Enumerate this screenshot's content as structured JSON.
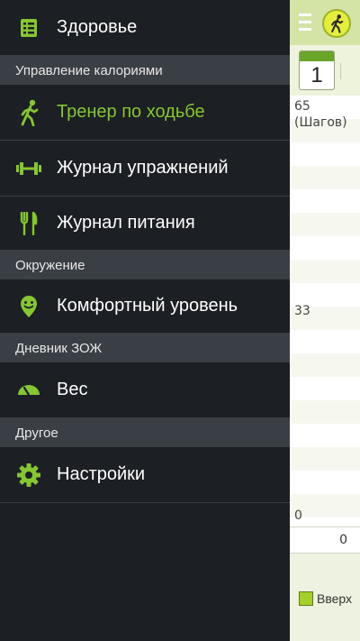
{
  "drawer": {
    "health": {
      "label": "Здоровье",
      "icon": "list-icon"
    },
    "sections": {
      "calories": "Управление калориями",
      "environment": "Окружение",
      "diary": "Дневник ЗОЖ",
      "other": "Другое"
    },
    "items": {
      "walking_coach": {
        "label": "Тренер по ходьбе",
        "icon": "walker-icon",
        "active": true
      },
      "exercise_log": {
        "label": "Журнал упражнений",
        "icon": "dumbbell-icon"
      },
      "food_log": {
        "label": "Журнал питания",
        "icon": "fork-knife-icon"
      },
      "comfort_level": {
        "label": "Комфортный уровень",
        "icon": "smiley-icon"
      },
      "weight": {
        "label": "Вес",
        "icon": "scale-icon"
      },
      "settings": {
        "label": "Настройки",
        "icon": "gear-icon"
      }
    }
  },
  "peek": {
    "calendar_day": "1",
    "y_top": "65",
    "y_top_unit": "(Шагов)",
    "y_mid": "33",
    "y_bottom": "0",
    "total": "0",
    "legend": "Вверх"
  },
  "colors": {
    "accent": "#86c633",
    "drawer_bg": "#1c1f23",
    "section_bg": "#3a3e45",
    "header_bg": "#d4e4a6"
  }
}
